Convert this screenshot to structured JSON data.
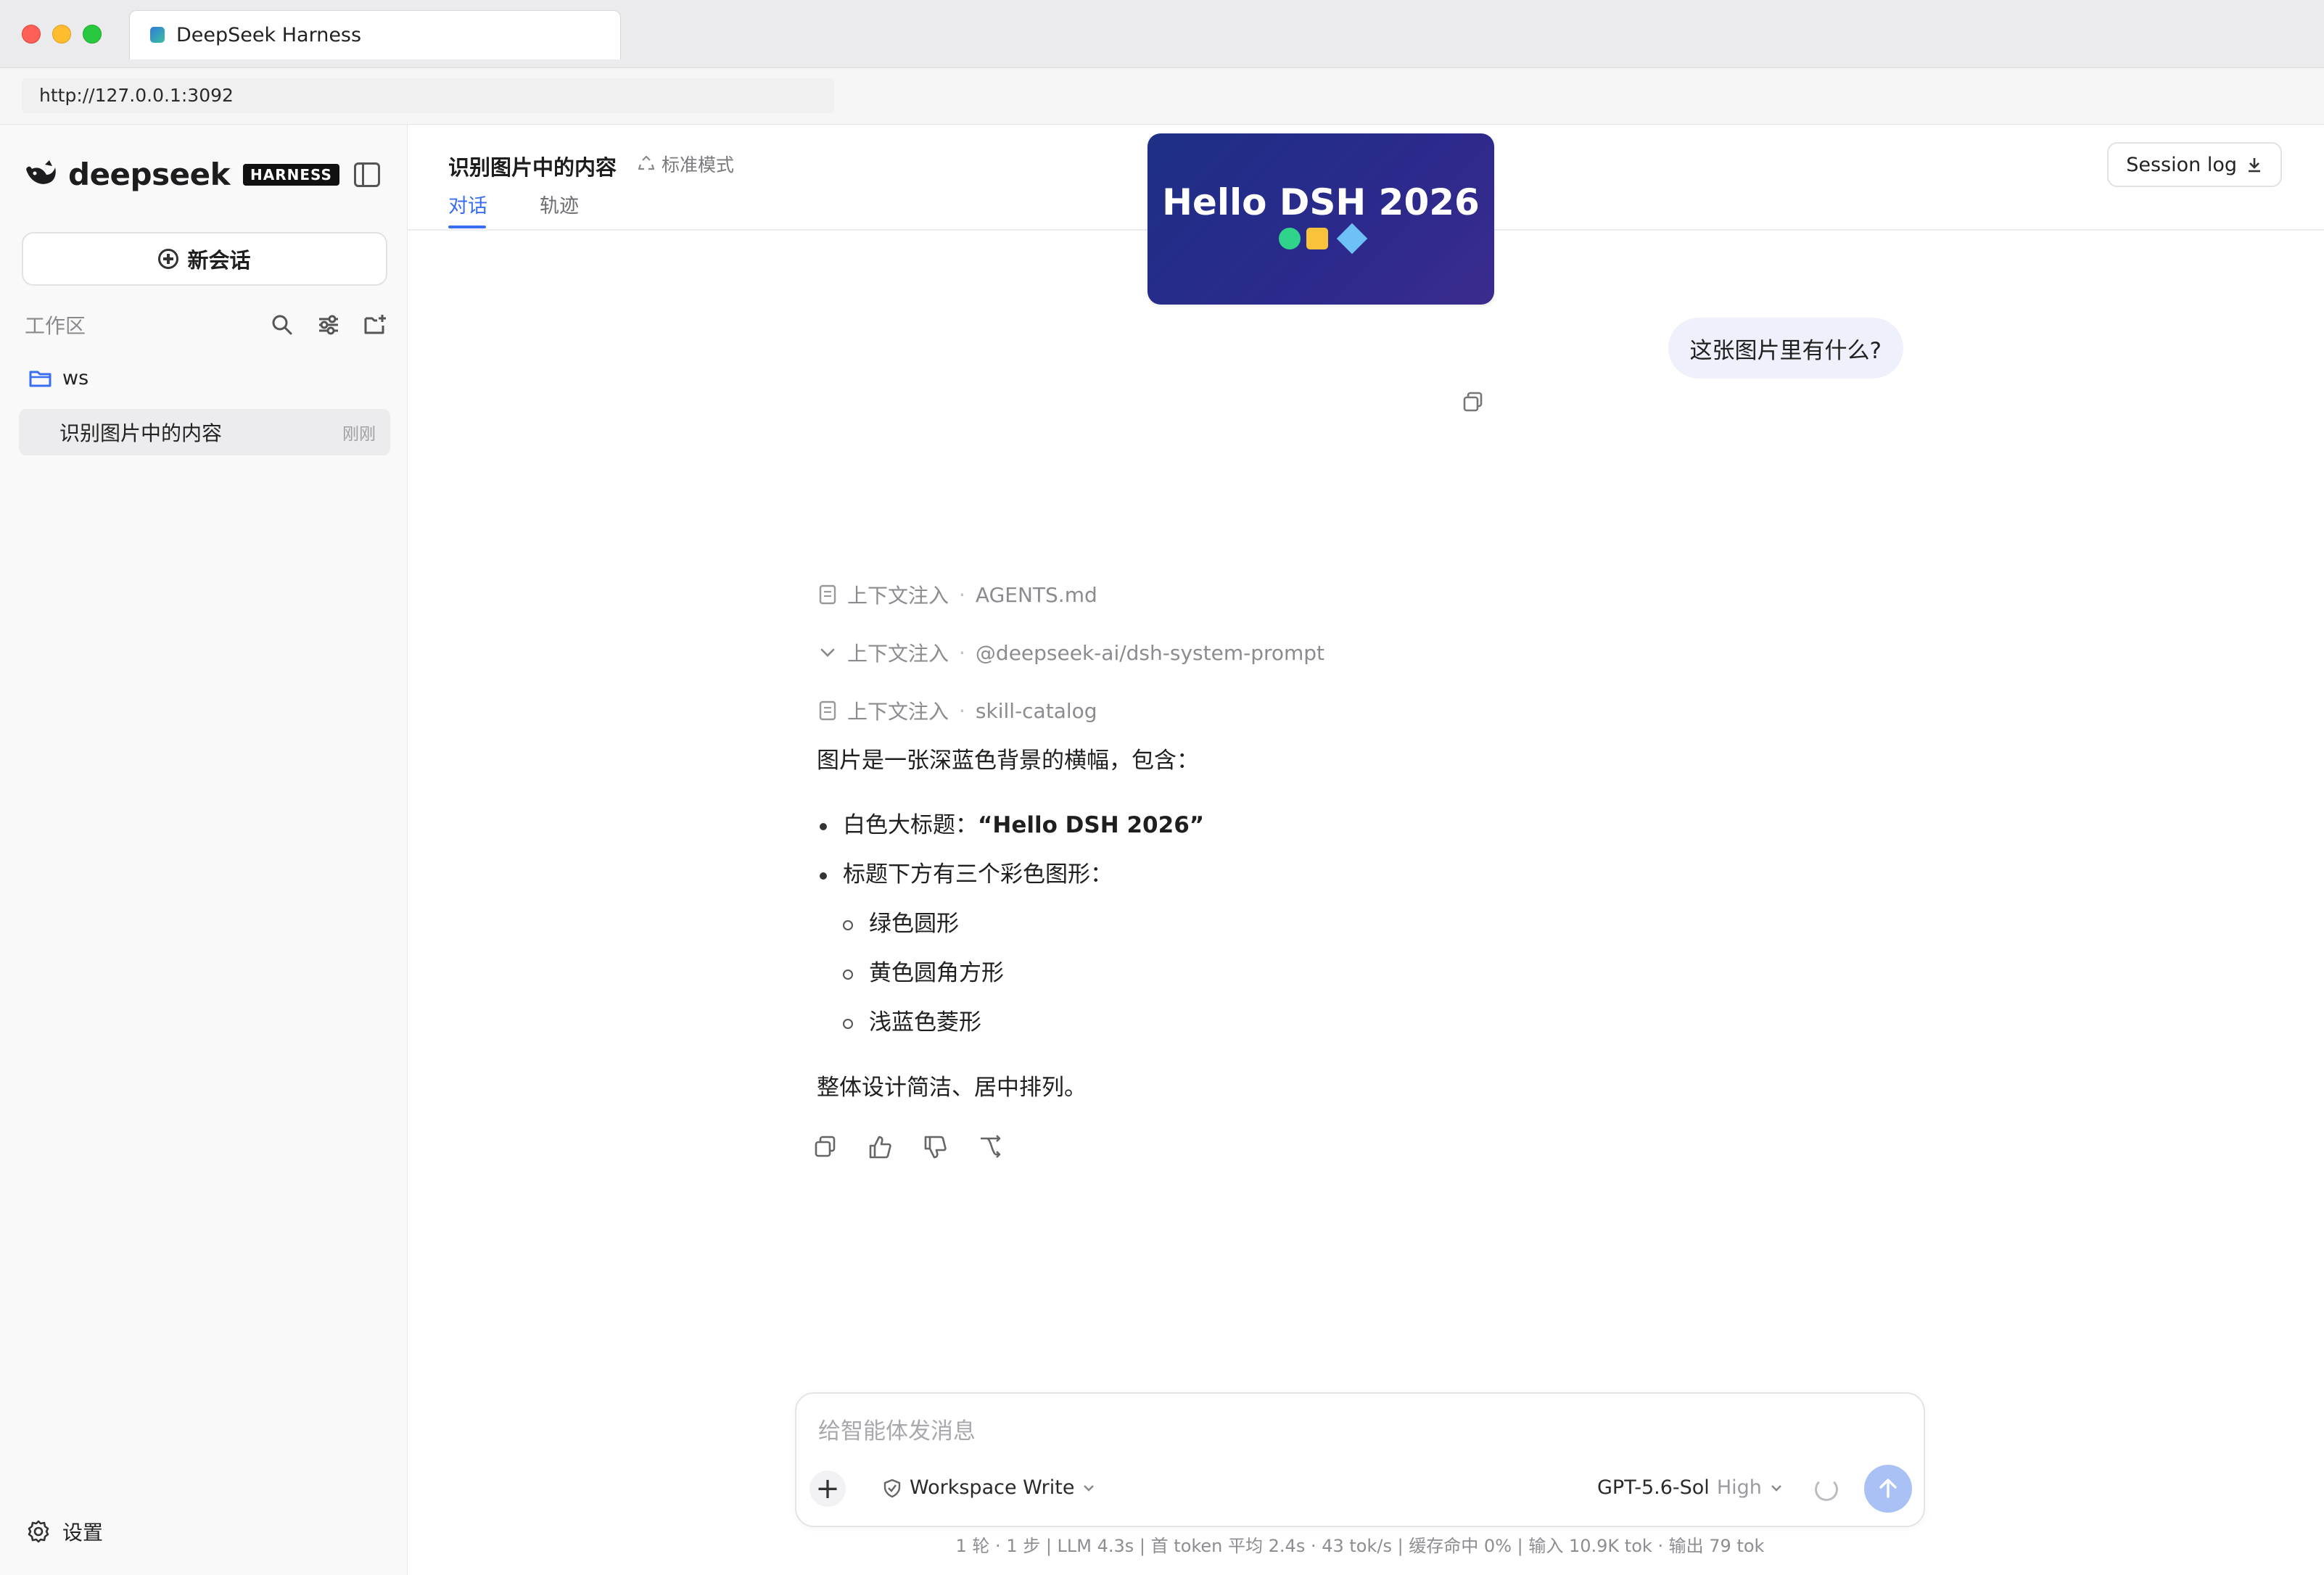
{
  "browser": {
    "tab_title": "DeepSeek Harness",
    "url": "http://127.0.0.1:3092"
  },
  "sidebar": {
    "brand_name": "deepseek",
    "brand_badge": "HARNESS",
    "new_chat_label": "新会话",
    "workspace_label": "工作区",
    "folder_name": "ws",
    "sessions": [
      {
        "title": "识别图片中的内容",
        "time": "刚刚"
      }
    ],
    "settings_label": "设置"
  },
  "header": {
    "title": "识别图片中的内容",
    "mode": "标准模式",
    "tabs": [
      {
        "label": "对话",
        "active": true
      },
      {
        "label": "轨迹",
        "active": false
      }
    ],
    "session_log_label": "Session log"
  },
  "chat": {
    "image": {
      "title": "Hello DSH 2026",
      "shape_colors": [
        "#2fd38a",
        "#f8c33a",
        "#6ec1f7"
      ]
    },
    "user_message": "这张图片里有什么?",
    "context_injections": [
      {
        "label": "上下文注入",
        "source": "AGENTS.md",
        "icon": "document-icon"
      },
      {
        "label": "上下文注入",
        "source": "@deepseek-ai/dsh-system-prompt",
        "icon": "chevron-down-icon"
      },
      {
        "label": "上下文注入",
        "source": "skill-catalog",
        "icon": "document-icon"
      }
    ],
    "answer": {
      "intro": "图片是一张深蓝色背景的横幅，包含：",
      "bullet1_prefix": "白色大标题：",
      "bullet1_bold": "“Hello DSH 2026”",
      "bullet2": "标题下方有三个彩色图形：",
      "sub_bullets": [
        "绿色圆形",
        "黄色圆角方形",
        "浅蓝色菱形"
      ],
      "conclusion": "整体设计简洁、居中排列。"
    }
  },
  "composer": {
    "placeholder": "给智能体发消息",
    "permission": "Workspace Write",
    "model": "GPT-5.6-Sol",
    "effort": "High"
  },
  "stats": {
    "text": "1 轮 · 1 步   |   LLM 4.3s   |   首 token 平均 2.4s · 43 tok/s   |   缓存命中 0%   |   输入 10.9K tok · 输出 79 tok"
  },
  "colors": {
    "accent": "#3a6ef2",
    "send_button": "#a9c1f5",
    "image_bg": "#2c2a8c"
  }
}
